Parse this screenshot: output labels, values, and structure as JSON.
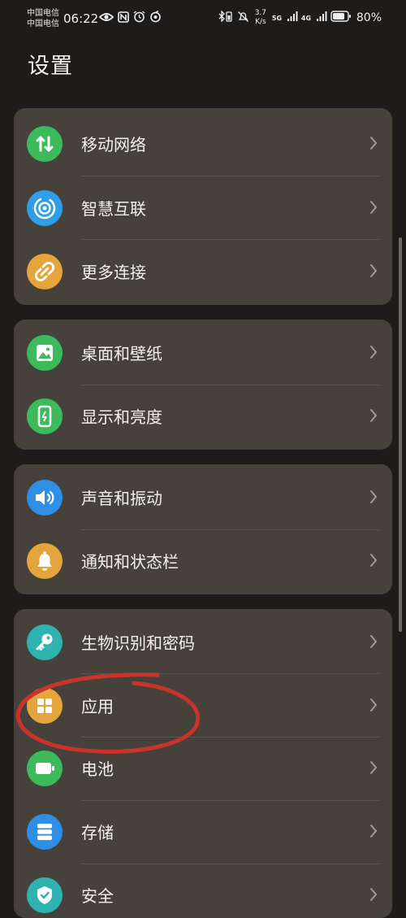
{
  "status_bar": {
    "carrier_1": "中国电信",
    "carrier_2": "中国电信",
    "time": "06:22",
    "speed_value": "3.7",
    "speed_unit": "K/s",
    "net_1": "5G",
    "net_2": "4G",
    "battery": "80%"
  },
  "page": {
    "title": "设置"
  },
  "groups": [
    {
      "items": [
        {
          "label": "移动网络",
          "icon": "mobile-data-icon",
          "color": "#3dbb5c"
        },
        {
          "label": "智慧互联",
          "icon": "smart-connect-icon",
          "color": "#2f9ee6"
        },
        {
          "label": "更多连接",
          "icon": "link-icon",
          "color": "#e5a53d"
        }
      ]
    },
    {
      "items": [
        {
          "label": "桌面和壁纸",
          "icon": "wallpaper-icon",
          "color": "#3dbb5c"
        },
        {
          "label": "显示和亮度",
          "icon": "display-icon",
          "color": "#3dbb5c"
        }
      ]
    },
    {
      "items": [
        {
          "label": "声音和振动",
          "icon": "sound-icon",
          "color": "#2f8fe6"
        },
        {
          "label": "通知和状态栏",
          "icon": "bell-icon",
          "color": "#e5a53d"
        }
      ]
    },
    {
      "items": [
        {
          "label": "生物识别和密码",
          "icon": "key-icon",
          "color": "#2fb3b0"
        },
        {
          "label": "应用",
          "icon": "apps-grid-icon",
          "color": "#e5a53d"
        },
        {
          "label": "电池",
          "icon": "battery-icon",
          "color": "#3dbb5c"
        },
        {
          "label": "存储",
          "icon": "storage-icon",
          "color": "#2f8fe6"
        },
        {
          "label": "安全",
          "icon": "shield-check-icon",
          "color": "#2fb3b0"
        }
      ]
    }
  ],
  "annotation": {
    "stroke_color": "#c8342a"
  }
}
